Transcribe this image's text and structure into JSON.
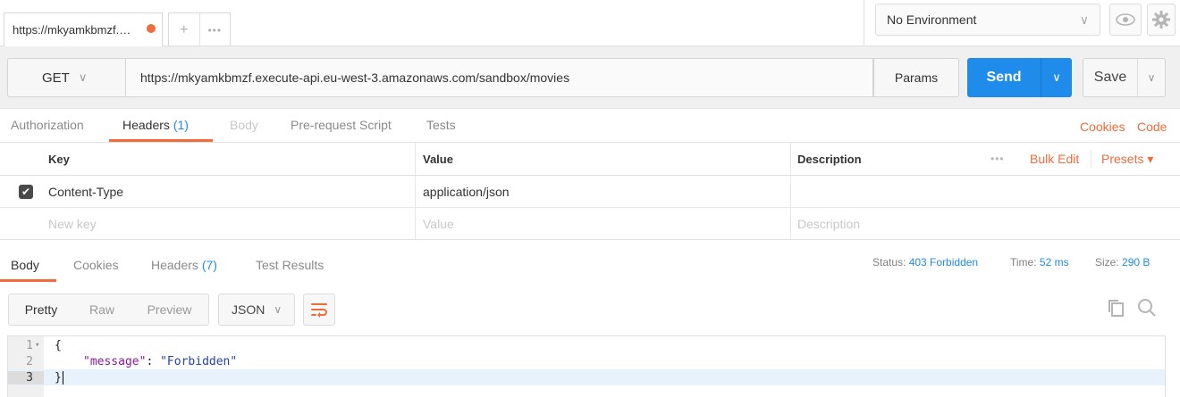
{
  "tab": {
    "title": "https://mkyamkbmzf.…"
  },
  "environment": {
    "selected": "No Environment"
  },
  "request": {
    "method": "GET",
    "url": "https://mkyamkbmzf.execute-api.eu-west-3.amazonaws.com/sandbox/movies",
    "params_label": "Params",
    "send_label": "Send",
    "save_label": "Save"
  },
  "request_tabs": {
    "authorization": "Authorization",
    "headers": "Headers",
    "headers_count": "(1)",
    "body": "Body",
    "prerequest": "Pre-request Script",
    "tests": "Tests",
    "cookies": "Cookies",
    "code": "Code"
  },
  "headers_table": {
    "col_key": "Key",
    "col_value": "Value",
    "col_description": "Description",
    "bulk_edit": "Bulk Edit",
    "presets": "Presets ▾",
    "rows": [
      {
        "key": "Content-Type",
        "value": "application/json",
        "description": ""
      }
    ],
    "placeholder": {
      "key": "New key",
      "value": "Value",
      "description": "Description"
    }
  },
  "response_tabs": {
    "body": "Body",
    "cookies": "Cookies",
    "headers": "Headers",
    "headers_count": "(7)",
    "test_results": "Test Results"
  },
  "response_meta": {
    "status_label": "Status:",
    "status_value": "403 Forbidden",
    "time_label": "Time:",
    "time_value": "52 ms",
    "size_label": "Size:",
    "size_value": "290 B"
  },
  "view_modes": [
    "Pretty",
    "Raw",
    "Preview"
  ],
  "format": "JSON",
  "code": {
    "line_numbers": [
      "1",
      "2",
      "3"
    ],
    "open": "{",
    "key": "\"message\"",
    "colon": ": ",
    "value": "\"Forbidden\"",
    "close": "}"
  },
  "colors": {
    "accent": "#f26b3a",
    "primary": "#1f8ceb"
  }
}
